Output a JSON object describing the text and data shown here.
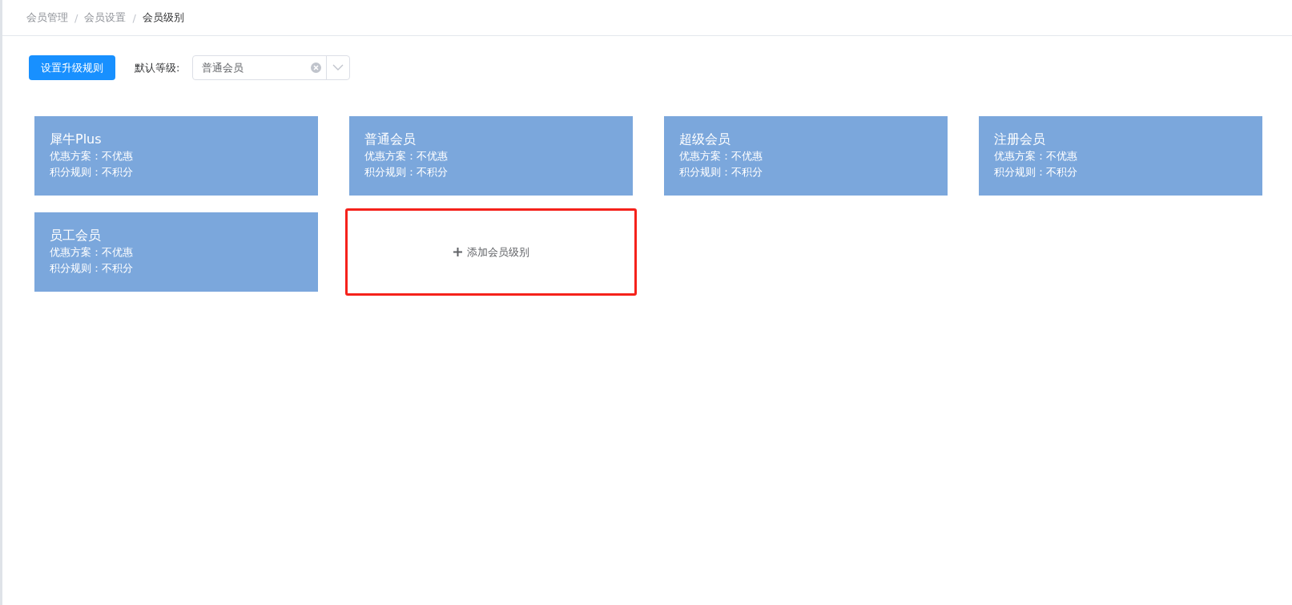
{
  "breadcrumb_separators": [
    "/",
    "/"
  ],
  "breadcrumb": [
    {
      "label": "会员管理",
      "current": false
    },
    {
      "label": "会员设置",
      "current": false
    },
    {
      "label": "会员级别",
      "current": true
    }
  ],
  "toolbar": {
    "button": "设置升级规则",
    "default_level_label": "默认等级:",
    "select": {
      "value": "普通会员"
    }
  },
  "levels": [
    {
      "name": "犀牛Plus",
      "discount": "优惠方案：不优惠",
      "points": "积分规则：不积分"
    },
    {
      "name": "普通会员",
      "discount": "优惠方案：不优惠",
      "points": "积分规则：不积分"
    },
    {
      "name": "超级会员",
      "discount": "优惠方案：不优惠",
      "points": "积分规则：不积分"
    },
    {
      "name": "注册会员",
      "discount": "优惠方案：不优惠",
      "points": "积分规则：不积分"
    },
    {
      "name": "员工会员",
      "discount": "优惠方案：不优惠",
      "points": "积分规则：不积分"
    }
  ],
  "add_card": {
    "label": "添加会员级别",
    "highlighted": true
  }
}
